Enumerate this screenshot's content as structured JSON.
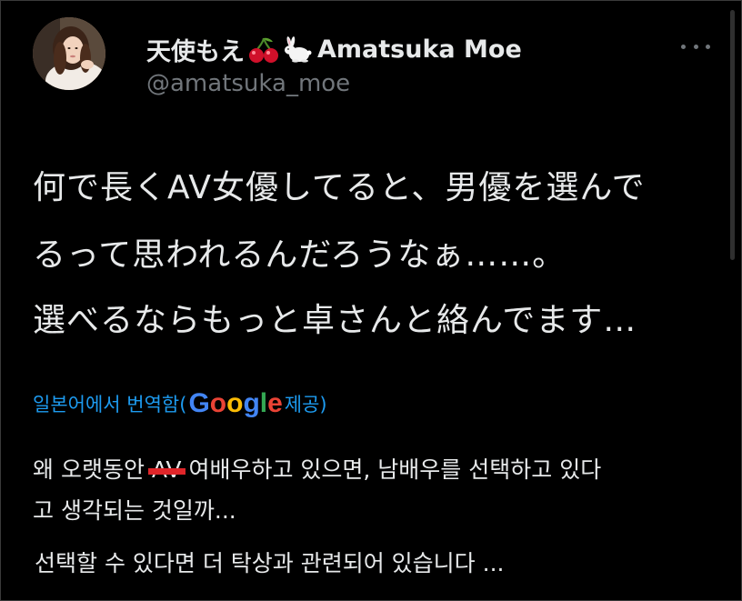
{
  "account": {
    "display_name_prefix": "天使もえ",
    "display_name_suffix": "Amatsuka Moe",
    "emoji_1": "cherry-emoji",
    "emoji_2": "rabbit-emoji",
    "handle": "@amatsuka_moe"
  },
  "tweet": {
    "lines": [
      "何で長くAV女優してると、男優を選んで",
      "るって思われるんだろうなぁ……。",
      "選べるならもっと卓さんと絡んでます…"
    ]
  },
  "translation": {
    "label_prefix": "일본어에서 번역함(",
    "google": [
      "G",
      "o",
      "o",
      "g",
      "l",
      "e"
    ],
    "label_suffix": " 제공)",
    "line1_before": "왜 오랫동안 ",
    "line1_struck": "AV",
    "line1_after": " 여배우하고 있으면, 남배우를 선택하고 있다",
    "line2": "고 생각되는 것일까...",
    "line3": "선택할 수 있다면 더 탁상과 관련되어 있습니다 ..."
  },
  "colors": {
    "background": "#000000",
    "text": "#e7e9ea",
    "secondary": "#71767b",
    "link": "#1d9bf0",
    "strike": "#e0262a",
    "google_blue": "#4285f4",
    "google_red": "#ea4335",
    "google_yellow": "#fbbc05",
    "google_green": "#34a853"
  }
}
